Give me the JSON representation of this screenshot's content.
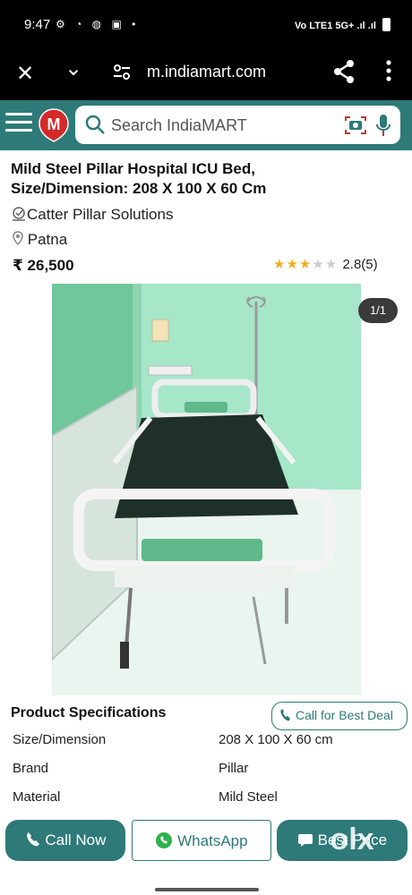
{
  "status": {
    "time": "9:47",
    "right_text": "Vo LTE1 5G+ .ıl .ıl"
  },
  "browser": {
    "close_icon": "✕",
    "chevron_icon": "⌄",
    "url": "m.indiamart.com"
  },
  "header": {
    "search_placeholder": "Search IndiaMART"
  },
  "product": {
    "title": "Mild Steel Pillar Hospital ICU Bed, Size/Dimension: 208 X 100 X 60 Cm",
    "company": "Catter Pillar Solutions",
    "location": "Patna",
    "price": "₹ 26,500",
    "rating_text": "2.8(5)",
    "stars_filled": 3,
    "stars_total": 5,
    "image_counter": "1/1"
  },
  "specs": {
    "title": "Product Specifications",
    "call_best_deal": "Call for Best Deal",
    "rows": [
      {
        "key": "Size/Dimension",
        "value": "208 X 100 X 60 cm"
      },
      {
        "key": "Brand",
        "value": "Pillar"
      },
      {
        "key": "Material",
        "value": "Mild Steel"
      }
    ]
  },
  "actions": {
    "call_now": "Call Now",
    "whatsapp": "WhatsApp",
    "best_price": "Best Price",
    "watermark": "olx"
  },
  "colors": {
    "brand": "#2e7a78",
    "star": "#f2b01e"
  }
}
